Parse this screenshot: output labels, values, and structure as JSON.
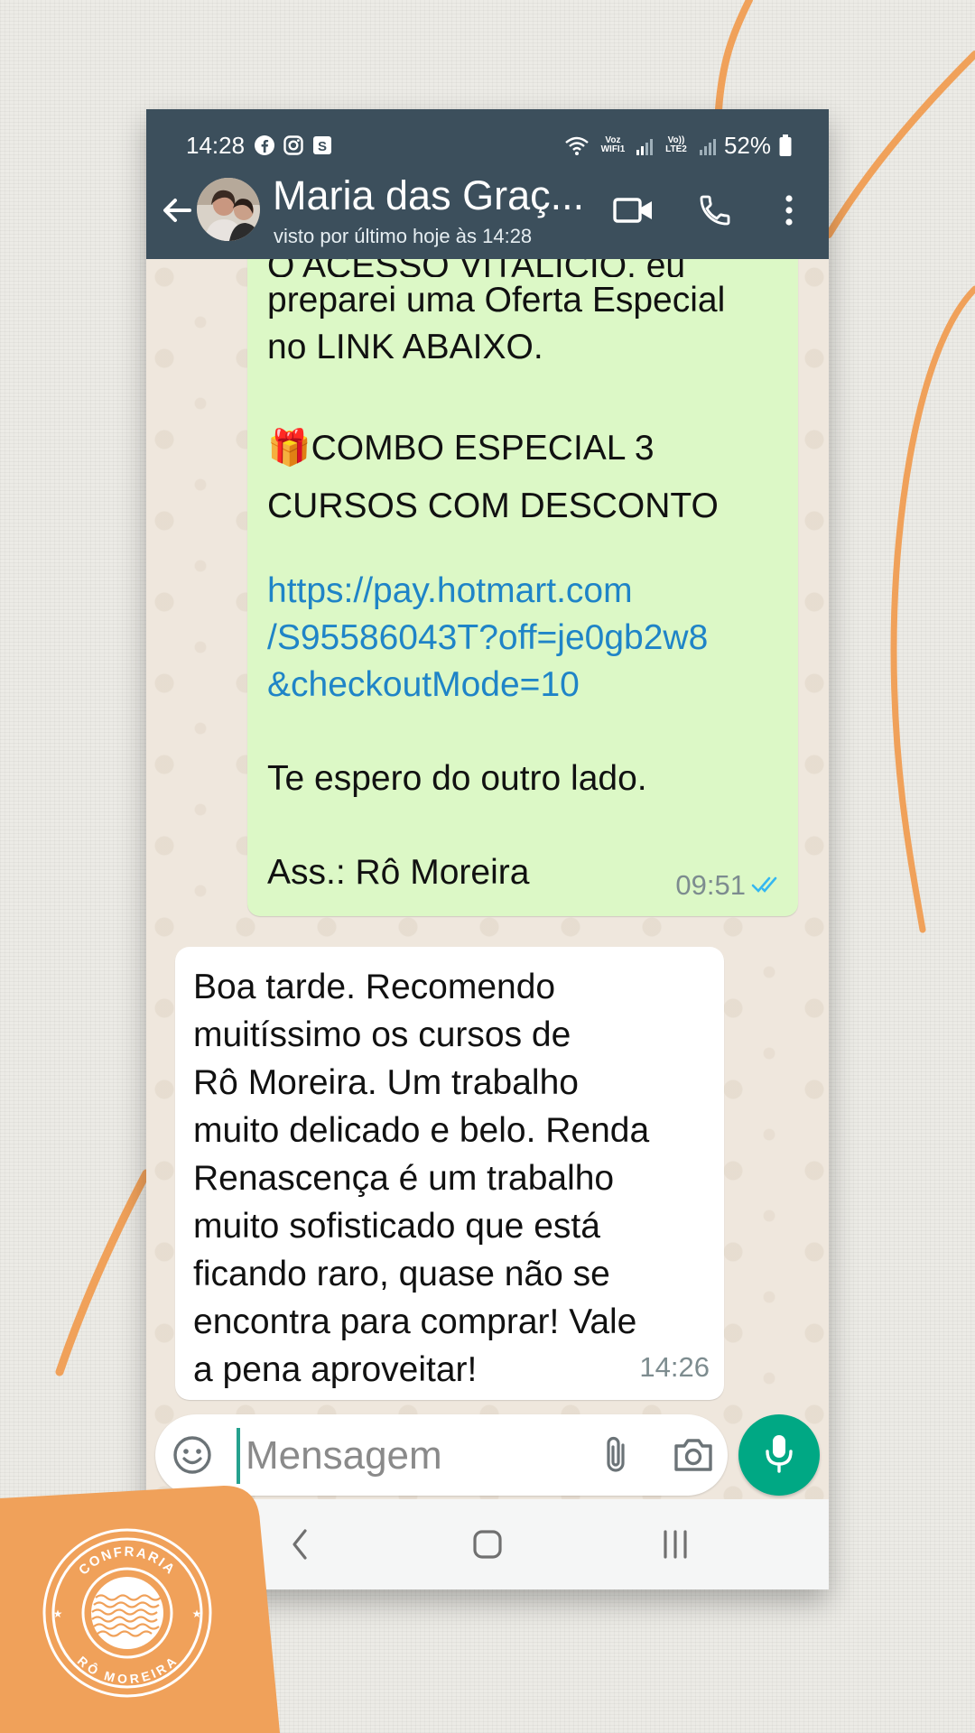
{
  "status_bar": {
    "time": "14:28",
    "battery": "52%",
    "wifi_label": "Voz WIFI1",
    "lte_label": "Vo)) LTE2"
  },
  "header": {
    "contact_name": "Maria das Graç...",
    "last_seen": "visto por último hoje às 14:28"
  },
  "outgoing_message": {
    "clipped_top": "O ACESSO VITALÍCIO, eu",
    "lines": [
      "preparei uma Oferta Especial",
      "no LINK ABAIXO."
    ],
    "gift_emoji": "🎁",
    "combo_lines": [
      "COMBO ESPECIAL 3",
      "CURSOS COM DESCONTO"
    ],
    "link_lines": [
      "https://pay.hotmart.com",
      "/S95586043T?off=je0gb2w8",
      "&checkoutMode=10"
    ],
    "closing": "Te espero do outro lado.",
    "signature": "Ass.: Rô Moreira",
    "time": "09:51",
    "status": "read"
  },
  "incoming_message": {
    "lines": [
      "Boa tarde. Recomendo",
      "muitíssimo os cursos de",
      "Rô Moreira. Um trabalho",
      "muito delicado e belo. Renda",
      "Renascença é um trabalho",
      "muito sofisticado que está",
      "ficando raro, quase não se",
      "encontra para comprar! Vale",
      "a pena aproveitar!"
    ],
    "time": "14:26"
  },
  "composer": {
    "placeholder": "Mensagem"
  },
  "brand": {
    "logo_top_text": "CONFRARIA",
    "logo_bottom_text": "RÔ MOREIRA"
  },
  "colors": {
    "header": "#3c4f5c",
    "outgoing_bubble": "#dcf8c6",
    "incoming_bubble": "#ffffff",
    "link": "#1f84c7",
    "read_ticks": "#34b7f1",
    "mic_button": "#00a884",
    "brand_orange": "#f0a15a"
  }
}
